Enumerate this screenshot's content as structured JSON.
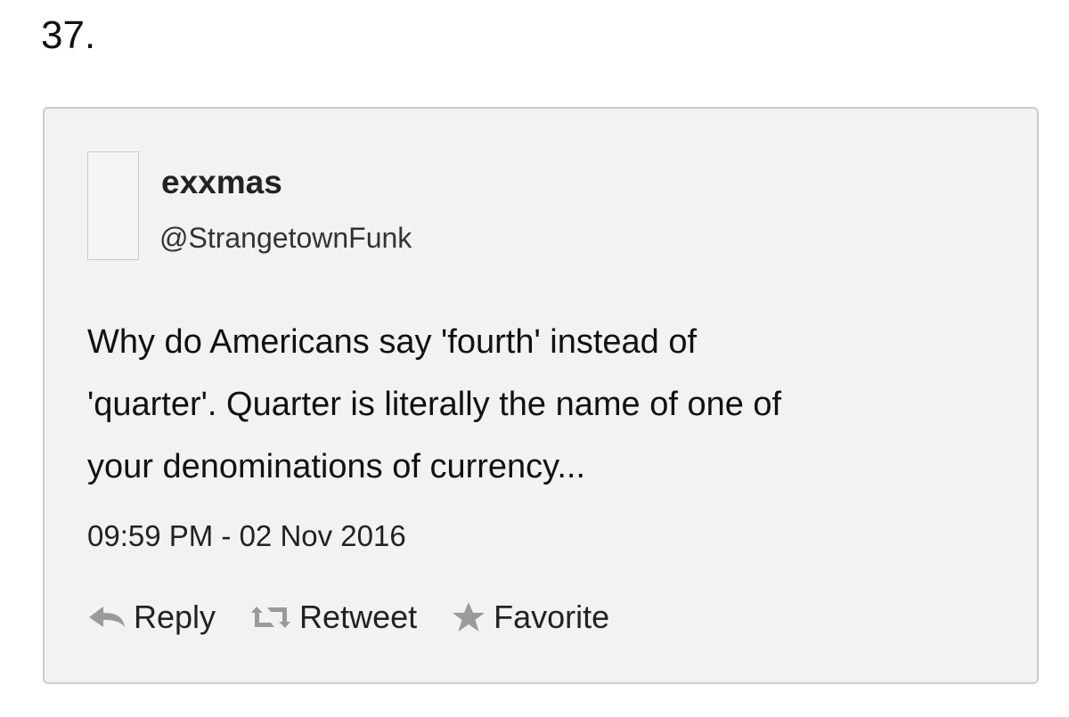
{
  "list": {
    "item_number": "37."
  },
  "tweet": {
    "display_name": "exxmas",
    "handle": "@StrangetownFunk",
    "text": "Why do Americans say 'fourth' instead of\n'quarter'. Quarter is literally the name of one of\nyour denominations of currency...",
    "timestamp": "09:59 PM - 02 Nov 2016"
  },
  "actions": {
    "reply_label": "Reply",
    "retweet_label": "Retweet",
    "favorite_label": "Favorite",
    "reply_icon": "reply-arrow-icon",
    "retweet_icon": "retweet-arrows-icon",
    "favorite_icon": "star-icon"
  },
  "colors": {
    "card_background": "#f2f2f2",
    "card_border": "#cccccc",
    "icon_gray": "#9a9a9a"
  }
}
